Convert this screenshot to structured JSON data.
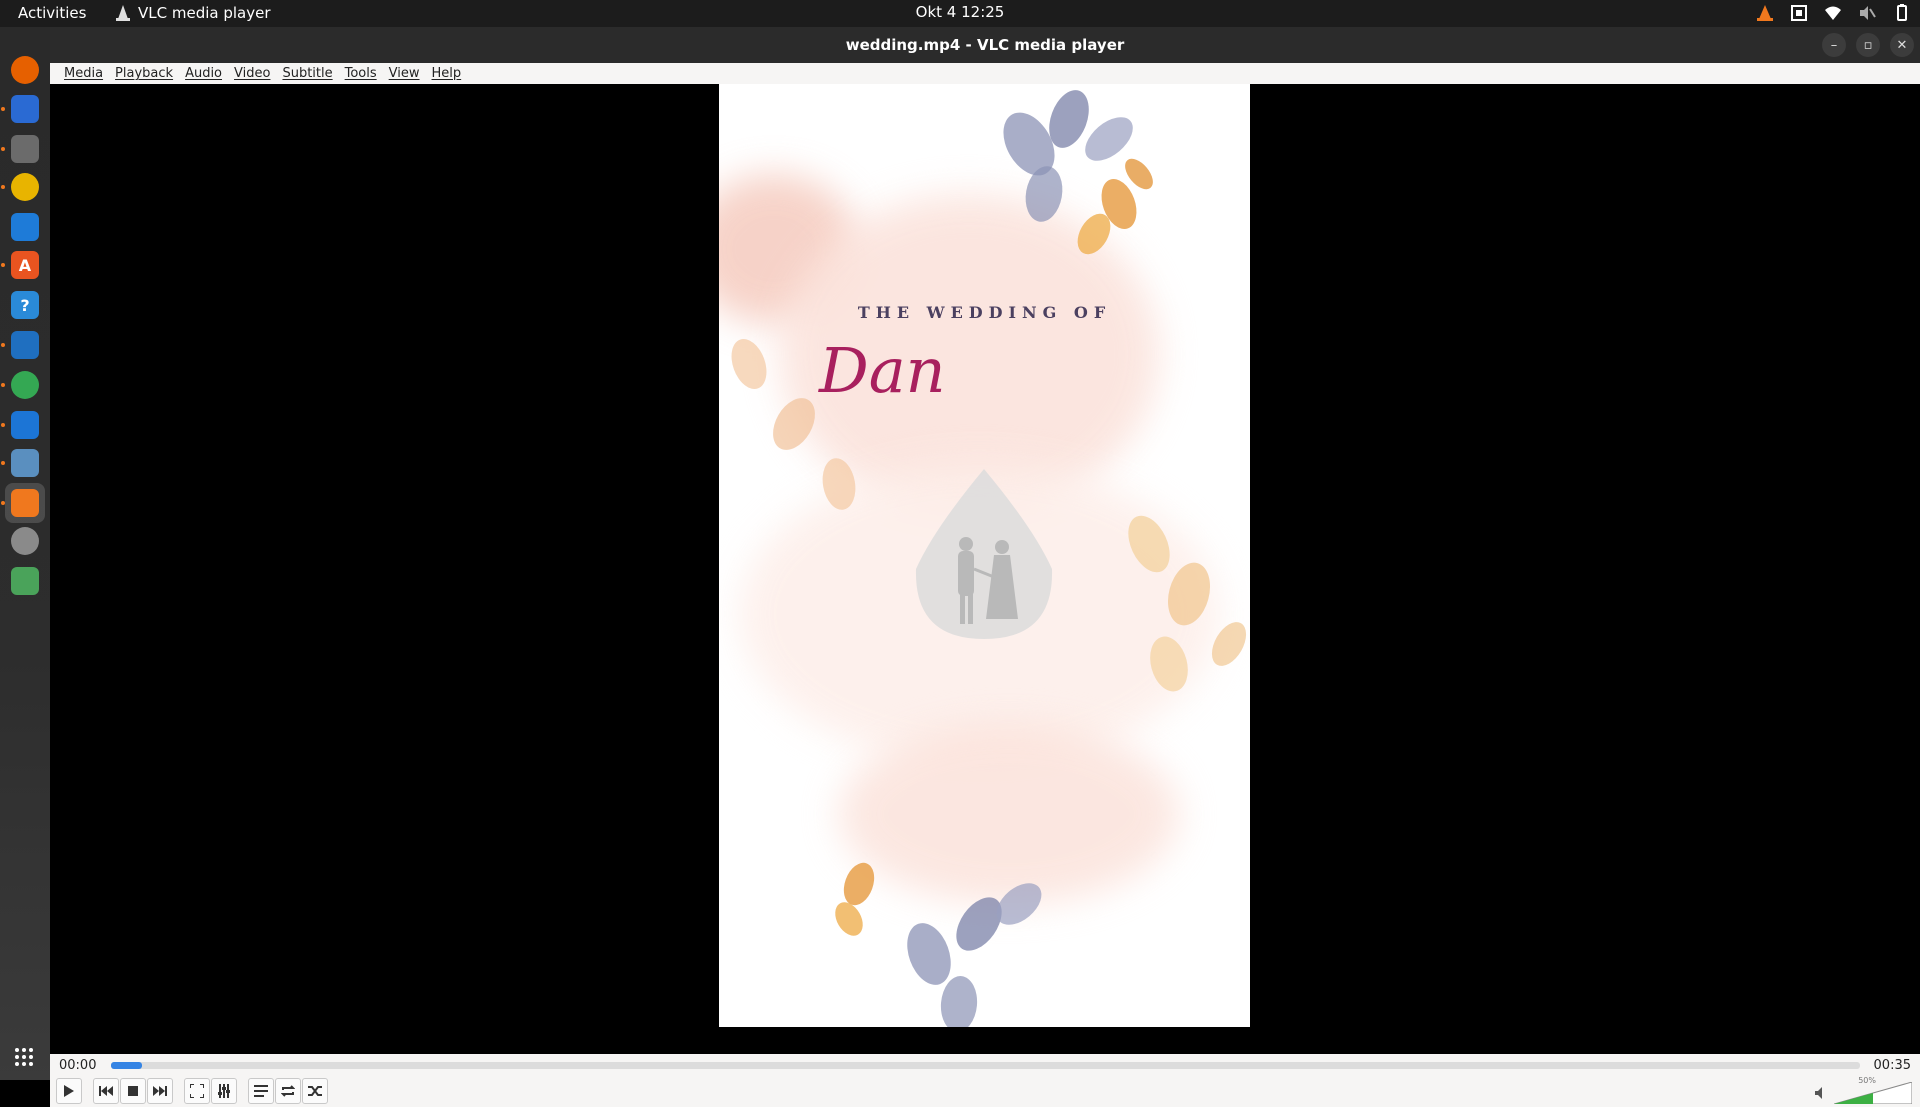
{
  "topbar": {
    "activities": "Activities",
    "app_name": "VLC media player",
    "clock": "Okt 4  12:25"
  },
  "dock": {
    "items": [
      {
        "name": "firefox-icon",
        "color": "#e66000",
        "symbol": ""
      },
      {
        "name": "thunderbird-icon",
        "color": "#2a6ad3",
        "symbol": ""
      },
      {
        "name": "files-icon",
        "color": "#6b6b6b",
        "symbol": ""
      },
      {
        "name": "rhythmbox-icon",
        "color": "#e8b400",
        "symbol": ""
      },
      {
        "name": "writer-icon",
        "color": "#1e7bd8",
        "symbol": ""
      },
      {
        "name": "software-center-icon",
        "color": "#e95420",
        "symbol": "A"
      },
      {
        "name": "help-icon",
        "color": "#2a8ad8",
        "symbol": "?"
      },
      {
        "name": "vscode-icon",
        "color": "#1f6fc0",
        "symbol": ""
      },
      {
        "name": "chrome-icon",
        "color": "#34a853",
        "symbol": ""
      },
      {
        "name": "remote-desktop-icon",
        "color": "#1c75d6",
        "symbol": ""
      },
      {
        "name": "gimp-icon",
        "color": "#5a8fbf",
        "symbol": ""
      },
      {
        "name": "vlc-icon",
        "color": "#f0781e",
        "symbol": ""
      },
      {
        "name": "settings-icon",
        "color": "#8a8a8a",
        "symbol": ""
      },
      {
        "name": "trash-icon",
        "color": "#4aa35a",
        "symbol": ""
      }
    ],
    "apps_grid_icon": "apps-grid-icon"
  },
  "window": {
    "title": "wedding.mp4 - VLC media player"
  },
  "menu": [
    "Media",
    "Playback",
    "Audio",
    "Video",
    "Subtitle",
    "Tools",
    "View",
    "Help"
  ],
  "video": {
    "heading": "THE WEDDING OF",
    "name": "Dan"
  },
  "controls": {
    "elapsed": "00:00",
    "total": "00:35",
    "progress_fraction": 0.018,
    "volume_label": "50%",
    "volume_fraction": 0.5,
    "accent_color": "#3584e4",
    "volume_color": "#3cb043"
  }
}
